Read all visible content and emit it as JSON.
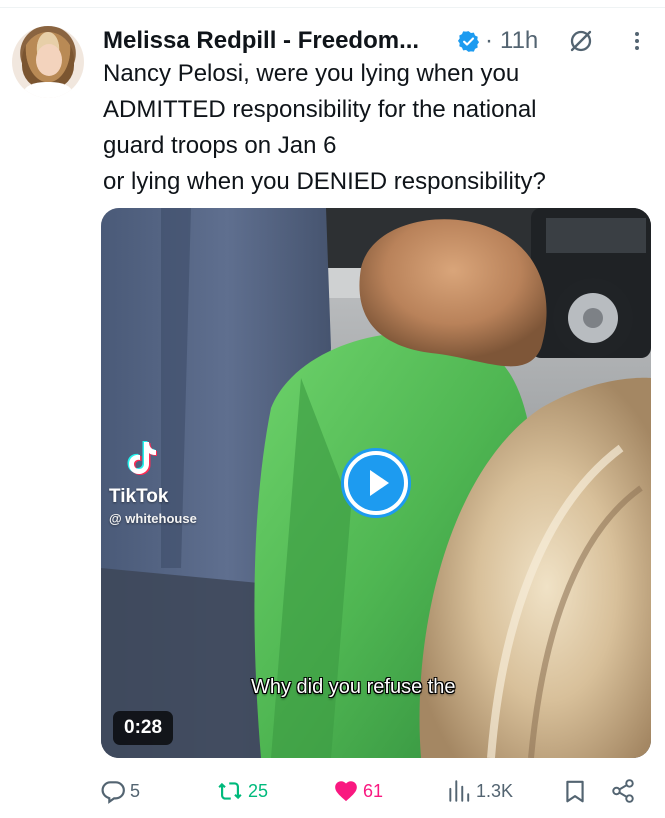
{
  "tweet": {
    "author": {
      "display_name": "Melissa Redpill - Freedom...",
      "verified": true,
      "verified_color": "#1d9bf0"
    },
    "separator": "·",
    "timestamp": "11h",
    "text_lines": [
      "Nancy Pelosi, were you lying when you",
      "ADMITTED responsibility for the national",
      "guard troops on Jan 6",
      "or lying when you DENIED responsibility?"
    ],
    "media": {
      "type": "video",
      "watermark": {
        "app_name": "TikTok",
        "handle": "@ whitehouse"
      },
      "caption": "Why did you refuse the",
      "duration": "0:28",
      "play_icon": "play-icon"
    },
    "actions": {
      "replies": "5",
      "reposts": "25",
      "likes": "61",
      "views": "1.3K",
      "liked": true,
      "reposted": true
    }
  },
  "colors": {
    "secondary_text": "#536471",
    "accent_blue": "#1d9bf0",
    "repost_green": "#00ba7c",
    "like_pink": "#f91880"
  }
}
